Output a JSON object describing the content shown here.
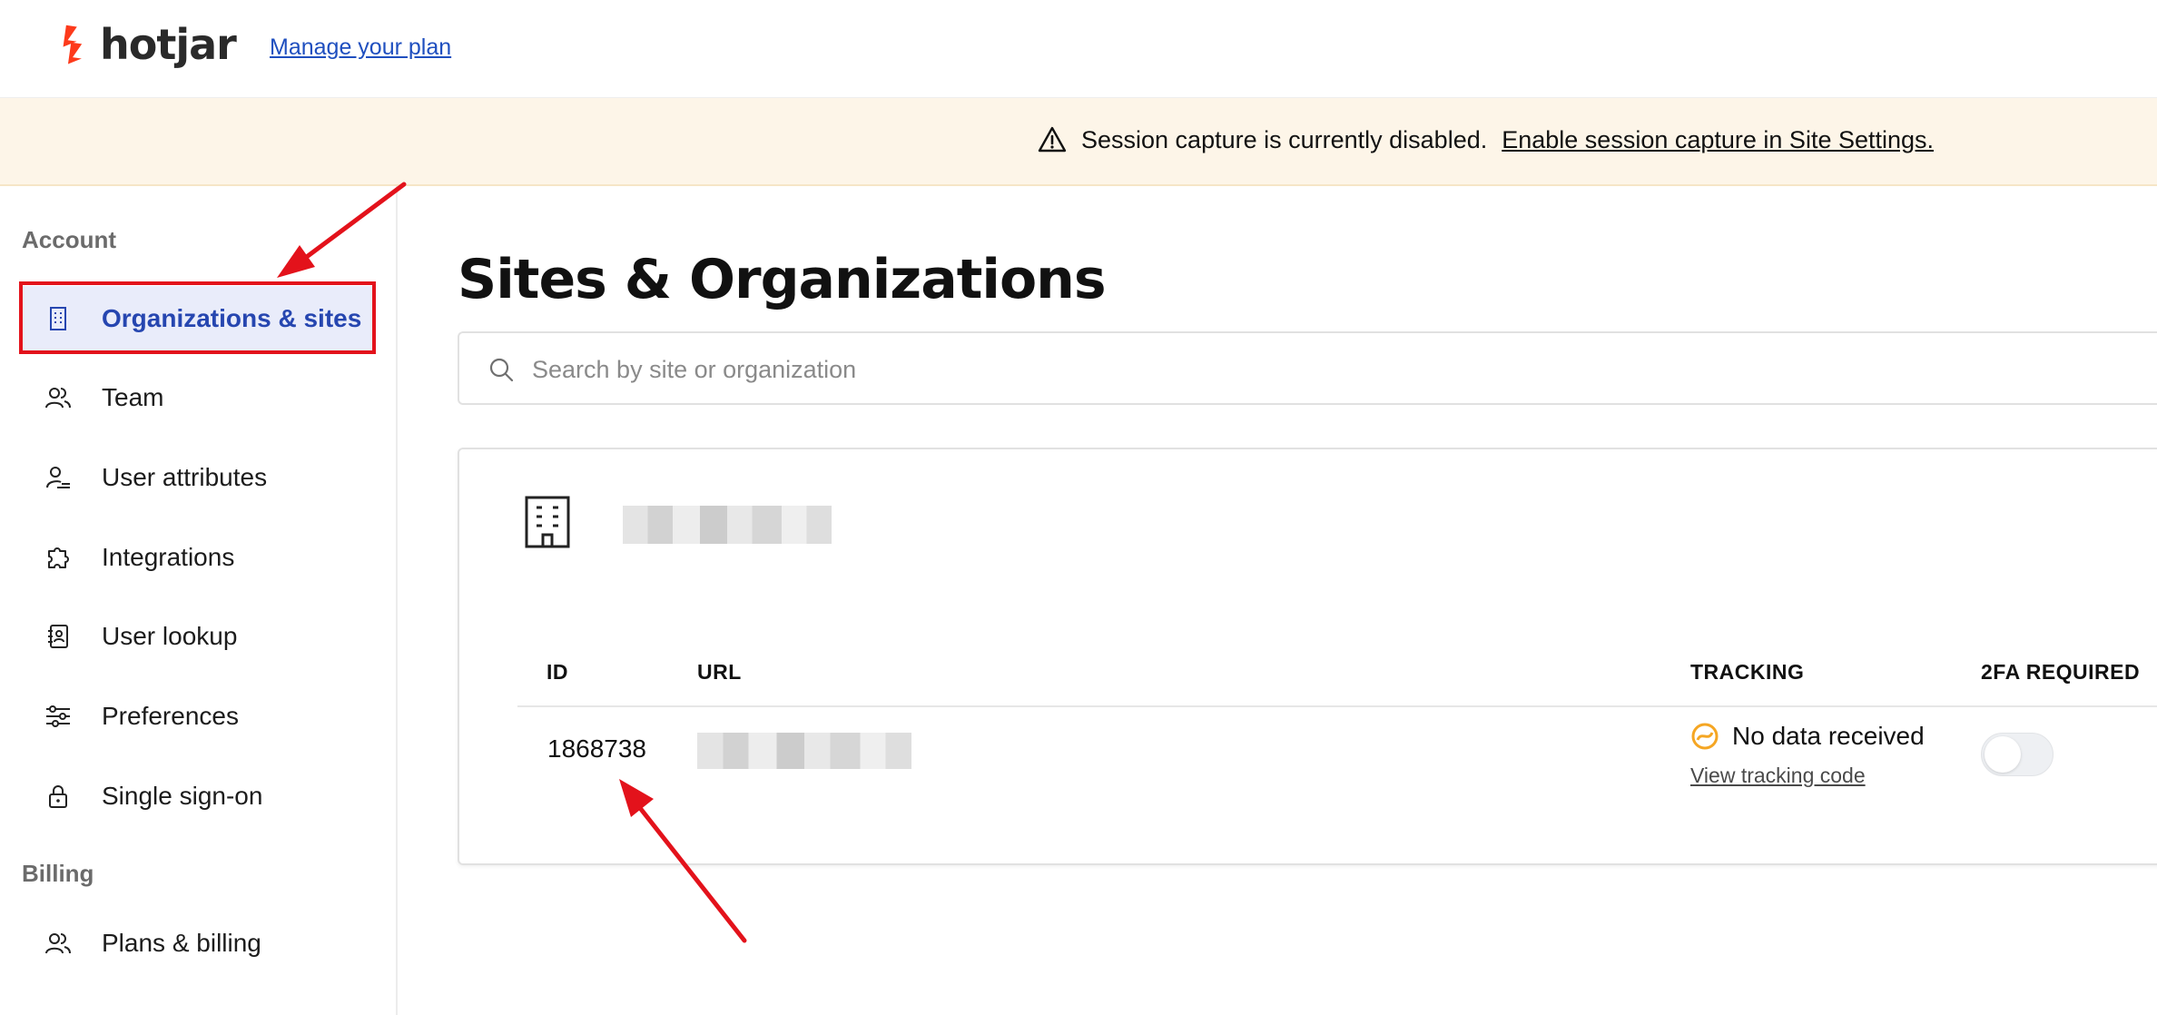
{
  "header": {
    "logo_text": "hotjar",
    "manage_plan_link": "Manage your plan"
  },
  "banner": {
    "message": "Session capture is currently disabled.",
    "link": "Enable session capture in Site Settings."
  },
  "sidebar": {
    "sections": [
      {
        "label": "Account",
        "items": [
          {
            "label": "Organizations & sites",
            "icon": "building-icon",
            "active": true
          },
          {
            "label": "Team",
            "icon": "users-icon"
          },
          {
            "label": "User attributes",
            "icon": "user-attributes-icon"
          },
          {
            "label": "Integrations",
            "icon": "puzzle-icon"
          },
          {
            "label": "User lookup",
            "icon": "user-lookup-icon"
          },
          {
            "label": "Preferences",
            "icon": "sliders-icon"
          },
          {
            "label": "Single sign-on",
            "icon": "lock-icon"
          }
        ]
      },
      {
        "label": "Billing",
        "items": [
          {
            "label": "Plans & billing",
            "icon": "users-icon"
          }
        ]
      }
    ]
  },
  "main": {
    "title": "Sites & Organizations",
    "search": {
      "placeholder": "Search by site or organization",
      "value": ""
    },
    "organization": {
      "icon": "building-icon",
      "columns": {
        "id": "ID",
        "url": "URL",
        "tracking": "TRACKING",
        "twofa": "2FA REQUIRED"
      },
      "rows": [
        {
          "id": "1868738",
          "tracking_status": "No data received",
          "tracking_link": "View tracking code",
          "twofa_required": false
        }
      ]
    }
  },
  "colors": {
    "brand_orange": "#fd3a1b",
    "active_nav_text": "#2646b0",
    "active_nav_bg": "#e9ecfa",
    "banner_bg": "#fdf5e8",
    "status_orange": "#f5a623",
    "annotation_red": "#e3121b"
  }
}
